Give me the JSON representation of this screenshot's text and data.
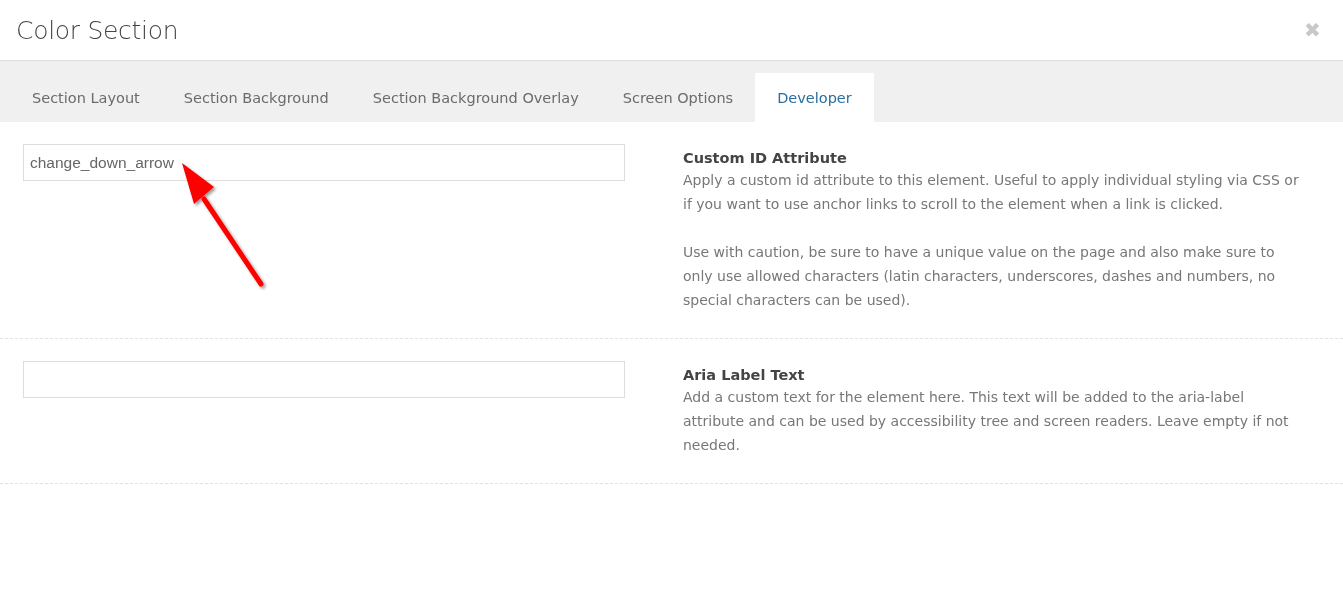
{
  "window": {
    "title": "Color Section",
    "close_icon": "✖"
  },
  "tabs": [
    {
      "label": "Section Layout",
      "selected": false
    },
    {
      "label": "Section Background",
      "selected": false
    },
    {
      "label": "Section Background Overlay",
      "selected": false
    },
    {
      "label": "Screen Options",
      "selected": false
    },
    {
      "label": "Developer",
      "selected": true
    }
  ],
  "options": [
    {
      "label": "Custom ID Attribute",
      "value": "change_down_arrow",
      "annotated": true,
      "description": [
        "Apply a custom id attribute to this element. Useful to apply individual styling via CSS or if you want to use anchor links to scroll to the element when a link is clicked.",
        "Use with caution, be sure to have a unique value on the page and also make sure to only use allowed characters (latin characters, underscores, dashes and numbers, no special characters can be used)."
      ]
    },
    {
      "label": "Aria Label Text",
      "annotated": false,
      "description": [
        "Add a custom text for the element here. This text will be added to the aria-label attribute and can be used by accessibility tree and screen readers. Leave empty if not needed."
      ]
    }
  ]
}
